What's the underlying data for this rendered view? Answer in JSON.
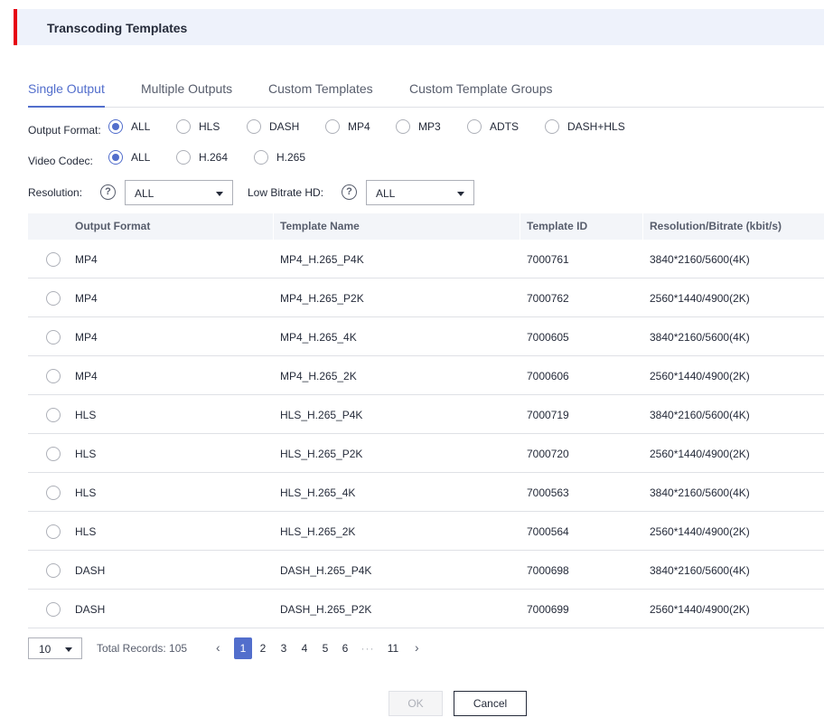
{
  "page": {
    "title": "Transcoding Templates",
    "accent": "#e60012",
    "brand": "#526ecc"
  },
  "tabs": [
    {
      "label": "Single Output",
      "active": true
    },
    {
      "label": "Multiple Outputs",
      "active": false
    },
    {
      "label": "Custom Templates",
      "active": false
    },
    {
      "label": "Custom Template Groups",
      "active": false
    }
  ],
  "filters": {
    "output_format": {
      "label": "Output Format:",
      "options": [
        "ALL",
        "HLS",
        "DASH",
        "MP4",
        "MP3",
        "ADTS",
        "DASH+HLS"
      ],
      "selected": "ALL"
    },
    "video_codec": {
      "label": "Video Codec:",
      "options": [
        "ALL",
        "H.264",
        "H.265"
      ],
      "selected": "ALL"
    },
    "resolution": {
      "label": "Resolution:",
      "help_icon": "question-circle-icon",
      "value": "ALL"
    },
    "low_bitrate_hd": {
      "label": "Low Bitrate HD:",
      "help_icon": "question-circle-icon",
      "value": "ALL"
    }
  },
  "table": {
    "columns": [
      "Output Format",
      "Template Name",
      "Template ID",
      "Resolution/Bitrate (kbit/s)"
    ],
    "rows": [
      [
        "MP4",
        "MP4_H.265_P4K",
        "7000761",
        "3840*2160/5600(4K)"
      ],
      [
        "MP4",
        "MP4_H.265_P2K",
        "7000762",
        "2560*1440/4900(2K)"
      ],
      [
        "MP4",
        "MP4_H.265_4K",
        "7000605",
        "3840*2160/5600(4K)"
      ],
      [
        "MP4",
        "MP4_H.265_2K",
        "7000606",
        "2560*1440/4900(2K)"
      ],
      [
        "HLS",
        "HLS_H.265_P4K",
        "7000719",
        "3840*2160/5600(4K)"
      ],
      [
        "HLS",
        "HLS_H.265_P2K",
        "7000720",
        "2560*1440/4900(2K)"
      ],
      [
        "HLS",
        "HLS_H.265_4K",
        "7000563",
        "3840*2160/5600(4K)"
      ],
      [
        "HLS",
        "HLS_H.265_2K",
        "7000564",
        "2560*1440/4900(2K)"
      ],
      [
        "DASH",
        "DASH_H.265_P4K",
        "7000698",
        "3840*2160/5600(4K)"
      ],
      [
        "DASH",
        "DASH_H.265_P2K",
        "7000699",
        "2560*1440/4900(2K)"
      ]
    ]
  },
  "pagination": {
    "page_size": "10",
    "total": "Total Records: 105",
    "pages": [
      "1",
      "2",
      "3",
      "4",
      "5",
      "6",
      "···",
      "11"
    ],
    "current": "1",
    "prev_icon": "chevron-left-icon",
    "next_icon": "chevron-right-icon"
  },
  "footer": {
    "ok_label": "OK",
    "cancel_label": "Cancel"
  }
}
